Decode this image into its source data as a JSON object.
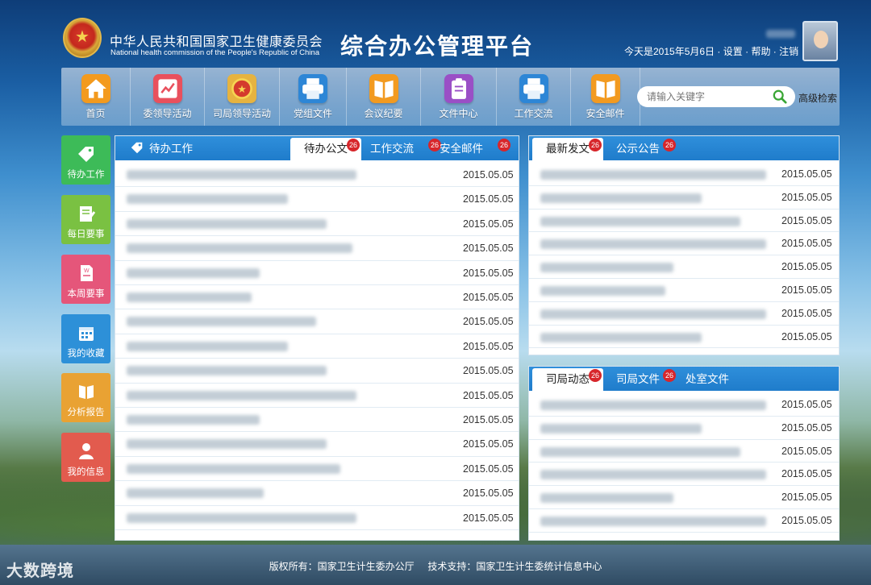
{
  "header": {
    "org_cn": "中华人民共和国国家卫生健康委员会",
    "org_en": "National health commission of the People's Republic of China",
    "platform_title": "综合办公管理平台",
    "date_text": "今天是2015年5月6日",
    "links": [
      "设置",
      "帮助",
      "注销"
    ],
    "separator": "·"
  },
  "nav": {
    "items": [
      {
        "label": "首页",
        "icon": "home-icon",
        "color": "#f39a1e"
      },
      {
        "label": "委领导活动",
        "icon": "chart-icon",
        "color": "#e9505d"
      },
      {
        "label": "司局领导活动",
        "icon": "emblem-icon",
        "color": "#e6b340"
      },
      {
        "label": "党组文件",
        "icon": "printer-icon",
        "color": "#2d86d6"
      },
      {
        "label": "会议纪要",
        "icon": "book-icon",
        "color": "#f29a20"
      },
      {
        "label": "文件中心",
        "icon": "clipboard-icon",
        "color": "#9a4fc6"
      },
      {
        "label": "工作交流",
        "icon": "printer-icon",
        "color": "#2d86d6"
      },
      {
        "label": "安全邮件",
        "icon": "book-icon",
        "color": "#f29a20"
      }
    ],
    "search_placeholder": "请输入关键字",
    "advanced_search": "高级检索"
  },
  "sidebar": {
    "items": [
      {
        "label": "待办工作",
        "icon": "tag-icon",
        "color": "#3dbb58"
      },
      {
        "label": "每日要事",
        "icon": "notepad-icon",
        "color": "#7ac142"
      },
      {
        "label": "本周要事",
        "icon": "document-icon",
        "color": "#e5567a"
      },
      {
        "label": "我的收藏",
        "icon": "calendar-icon",
        "color": "#2d90d8"
      },
      {
        "label": "分析报告",
        "icon": "book-icon",
        "color": "#e9a233"
      },
      {
        "label": "我的信息",
        "icon": "user-icon",
        "color": "#e25b4e"
      }
    ]
  },
  "panel_todo": {
    "title": "待办工作",
    "tabs": [
      {
        "label": "待办公文",
        "badge": "26"
      },
      {
        "label": "工作交流",
        "badge": "26"
      },
      {
        "label": "安全邮件",
        "badge": "26"
      }
    ],
    "dates": [
      "2015.05.05",
      "2015.05.05",
      "2015.05.05",
      "2015.05.05",
      "2015.05.05",
      "2015.05.05",
      "2015.05.05",
      "2015.05.05",
      "2015.05.05",
      "2015.05.05",
      "2015.05.05",
      "2015.05.05",
      "2015.05.05",
      "2015.05.05",
      "2015.05.05"
    ]
  },
  "panel_latest": {
    "tabs": [
      {
        "label": "最新发文",
        "badge": "26"
      },
      {
        "label": "公示公告",
        "badge": "26"
      }
    ],
    "dates": [
      "2015.05.05",
      "2015.05.05",
      "2015.05.05",
      "2015.05.05",
      "2015.05.05",
      "2015.05.05",
      "2015.05.05",
      "2015.05.05"
    ]
  },
  "panel_dept": {
    "tabs": [
      {
        "label": "司局动态",
        "badge": "26"
      },
      {
        "label": "司局文件",
        "badge": "26"
      },
      {
        "label": "处室文件",
        "badge": ""
      }
    ],
    "dates": [
      "2015.05.05",
      "2015.05.05",
      "2015.05.05",
      "2015.05.05",
      "2015.05.05",
      "2015.05.05"
    ]
  },
  "footer": {
    "copyright": "版权所有：国家卫生计生委办公厅",
    "support": "技术支持：国家卫生计生委统计信息中心"
  },
  "watermark": "大数跨境"
}
